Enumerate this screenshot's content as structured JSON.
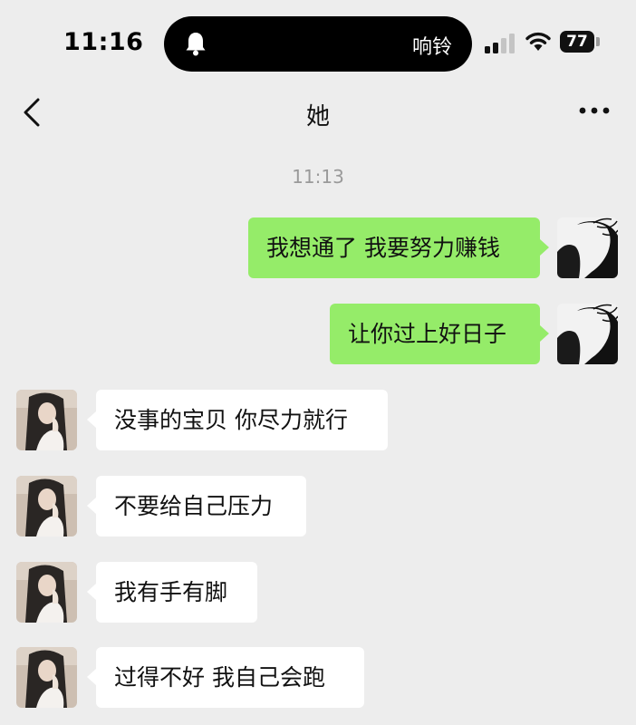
{
  "status_bar": {
    "time": "11:16",
    "island_icon": "bell-icon",
    "ring_label": "响铃",
    "signal_icon": "cellular-signal-icon",
    "wifi_icon": "wifi-icon",
    "battery_level": "77"
  },
  "nav": {
    "back_icon": "chevron-left-icon",
    "title": "她",
    "more_icon": "more-dots-icon"
  },
  "chat": {
    "timestamp": "11:13",
    "colors": {
      "outgoing_bubble": "#95ec69",
      "incoming_bubble": "#ffffff",
      "background": "#ededed"
    },
    "messages": [
      {
        "direction": "out",
        "text": "我想通了 我要努力赚钱"
      },
      {
        "direction": "out",
        "text": "让你过上好日子"
      },
      {
        "direction": "in",
        "text": "没事的宝贝 你尽力就行"
      },
      {
        "direction": "in",
        "text": "不要给自己压力"
      },
      {
        "direction": "in",
        "text": "我有手有脚"
      },
      {
        "direction": "in",
        "text": "过得不好 我自己会跑"
      }
    ]
  }
}
